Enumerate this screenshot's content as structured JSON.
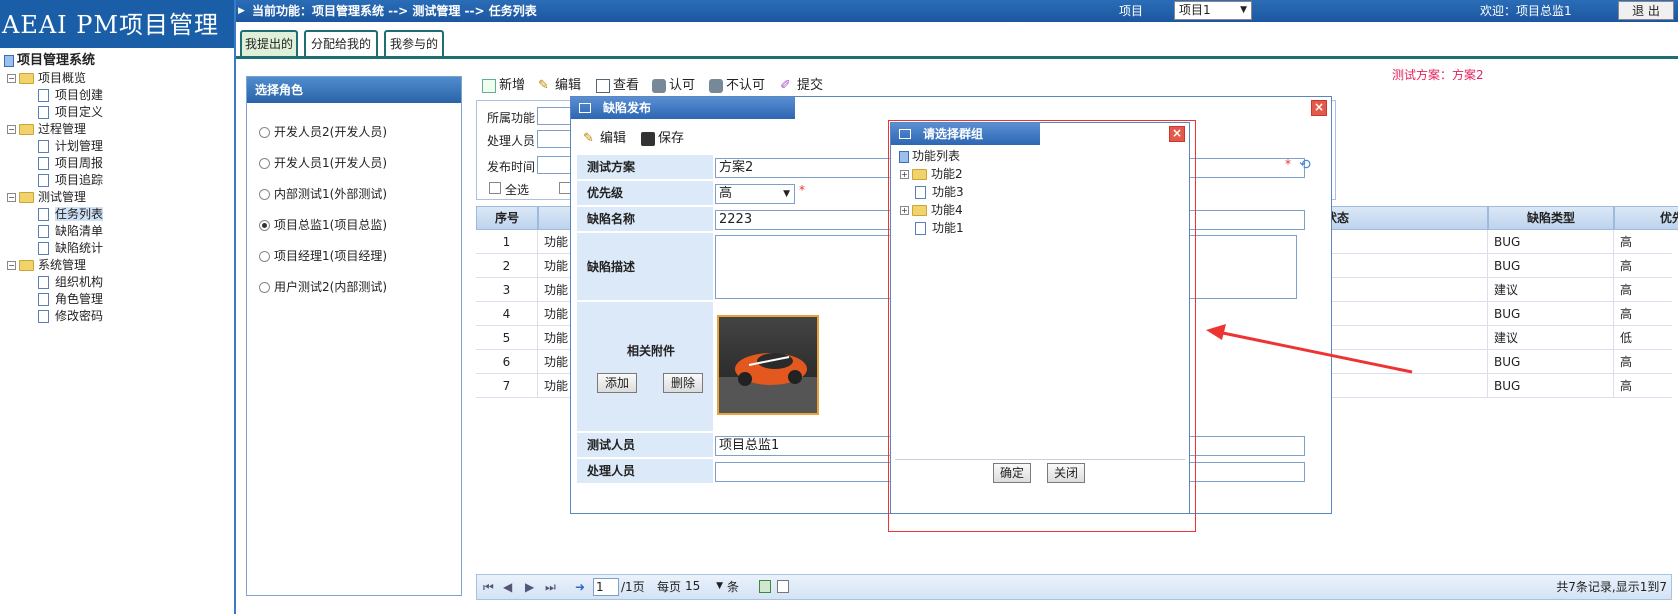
{
  "app_title": "AEAI PM项目管理",
  "topbar": {
    "current_function": "当前功能：项目管理系统 -->  测试管理 --> 任务列表",
    "project_label": "项目",
    "project_value": "项目1",
    "welcome": "欢迎：项目总监1",
    "exit_label": "退 出"
  },
  "tree": {
    "root": "项目管理系统",
    "groups": [
      {
        "label": "项目概览",
        "items": [
          "项目创建",
          "项目定义"
        ]
      },
      {
        "label": "过程管理",
        "items": [
          "计划管理",
          "项目周报",
          "项目追踪"
        ]
      },
      {
        "label": "测试管理",
        "items": [
          "任务列表",
          "缺陷清单",
          "缺陷统计"
        ]
      },
      {
        "label": "系统管理",
        "items": [
          "组织机构",
          "角色管理",
          "修改密码"
        ]
      }
    ]
  },
  "tabs": [
    "我提出的",
    "分配给我的",
    "我参与的"
  ],
  "roles": {
    "title": "选择角色",
    "options": [
      "开发人员2(开发人员)",
      "开发人员1(开发人员)",
      "内部测试1(外部测试)",
      "项目总监1(项目总监)",
      "项目经理1(项目经理)",
      "用户测试2(内部测试)"
    ],
    "selected_index": 3
  },
  "toolbar": {
    "new": "新增",
    "edit": "编辑",
    "view": "查看",
    "approve": "认可",
    "reject": "不认可",
    "submit": "提交"
  },
  "scheme_info": "测试方案：方案2",
  "filter": {
    "function_label": "所属功能",
    "handler_label": "处理人员",
    "publish_time_label": "发布时间",
    "select_all": "全选"
  },
  "grid": {
    "col_no": "序号",
    "col_state": "前状态",
    "col_type": "缺陷类型",
    "col_priority": "优先级",
    "rows": [
      {
        "no": "1",
        "func": "功能",
        "type": "BUG",
        "priority": "高"
      },
      {
        "no": "2",
        "func": "功能",
        "type": "BUG",
        "priority": "高"
      },
      {
        "no": "3",
        "func": "功能",
        "type": "建议",
        "priority": "高"
      },
      {
        "no": "4",
        "func": "功能",
        "type": "BUG",
        "priority": "高"
      },
      {
        "no": "5",
        "func": "功能",
        "type": "建议",
        "priority": "低"
      },
      {
        "no": "6",
        "func": "功能",
        "type": "BUG",
        "priority": "高"
      },
      {
        "no": "7",
        "func": "功能",
        "type": "BUG",
        "priority": "高"
      }
    ]
  },
  "pager": {
    "page": "1",
    "total_pages": "/1页",
    "per_page_label": "每页",
    "per_page": "15",
    "unit": "条",
    "summary": "共7条记录,显示1到7"
  },
  "defect_dialog": {
    "title": "缺陷发布",
    "edit": "编辑",
    "save": "保存",
    "scheme_label": "测试方案",
    "scheme_value": "方案2",
    "priority_label": "优先级",
    "priority_value": "高",
    "name_label": "缺陷名称",
    "name_value": "2223",
    "desc_label": "缺陷描述",
    "attach_label": "相关附件",
    "add_btn": "添加",
    "del_btn": "删除",
    "tester_label": "测试人员",
    "tester_value": "项目总监1",
    "handler_label": "处理人员",
    "required_mark": "*"
  },
  "group_dialog": {
    "title": "请选择群组",
    "root": "功能列表",
    "nodes": [
      "功能2",
      "功能3",
      "功能4",
      "功能1"
    ],
    "ok": "确定",
    "close": "关闭"
  },
  "colors": {
    "accent": "#1a5ea8",
    "tab_border": "#1f6e73",
    "highlight": "#e0245e",
    "arrow": "#e33"
  }
}
